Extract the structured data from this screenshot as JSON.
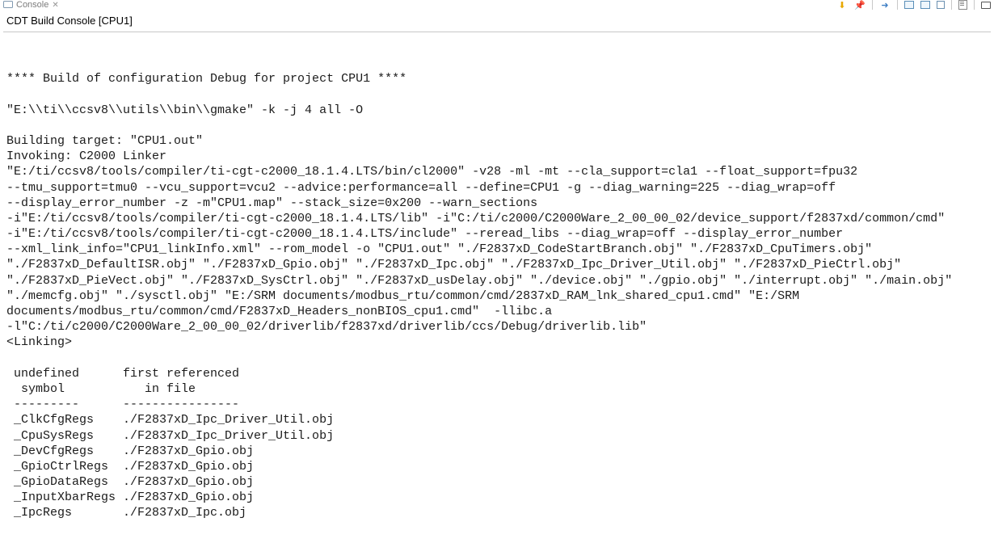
{
  "tab": {
    "title": "Console"
  },
  "header": {
    "title": "CDT Build Console [CPU1]"
  },
  "console": {
    "lines": [
      "",
      "**** Build of configuration Debug for project CPU1 ****",
      "",
      "\"E:\\\\ti\\\\ccsv8\\\\utils\\\\bin\\\\gmake\" -k -j 4 all -O ",
      "",
      "Building target: \"CPU1.out\"",
      "Invoking: C2000 Linker",
      "\"E:/ti/ccsv8/tools/compiler/ti-cgt-c2000_18.1.4.LTS/bin/cl2000\" -v28 -ml -mt --cla_support=cla1 --float_support=fpu32",
      "--tmu_support=tmu0 --vcu_support=vcu2 --advice:performance=all --define=CPU1 -g --diag_warning=225 --diag_wrap=off",
      "--display_error_number -z -m\"CPU1.map\" --stack_size=0x200 --warn_sections",
      "-i\"E:/ti/ccsv8/tools/compiler/ti-cgt-c2000_18.1.4.LTS/lib\" -i\"C:/ti/c2000/C2000Ware_2_00_00_02/device_support/f2837xd/common/cmd\"",
      "-i\"E:/ti/ccsv8/tools/compiler/ti-cgt-c2000_18.1.4.LTS/include\" --reread_libs --diag_wrap=off --display_error_number",
      "--xml_link_info=\"CPU1_linkInfo.xml\" --rom_model -o \"CPU1.out\" \"./F2837xD_CodeStartBranch.obj\" \"./F2837xD_CpuTimers.obj\"",
      "\"./F2837xD_DefaultISR.obj\" \"./F2837xD_Gpio.obj\" \"./F2837xD_Ipc.obj\" \"./F2837xD_Ipc_Driver_Util.obj\" \"./F2837xD_PieCtrl.obj\"",
      "\"./F2837xD_PieVect.obj\" \"./F2837xD_SysCtrl.obj\" \"./F2837xD_usDelay.obj\" \"./device.obj\" \"./gpio.obj\" \"./interrupt.obj\" \"./main.obj\"",
      "\"./memcfg.obj\" \"./sysctl.obj\" \"E:/SRM documents/modbus_rtu/common/cmd/2837xD_RAM_lnk_shared_cpu1.cmd\" \"E:/SRM",
      "documents/modbus_rtu/common/cmd/F2837xD_Headers_nonBIOS_cpu1.cmd\"  -llibc.a",
      "-l\"C:/ti/c2000/C2000Ware_2_00_00_02/driverlib/f2837xd/driverlib/ccs/Debug/driverlib.lib\" ",
      "<Linking>",
      "",
      " undefined      first referenced",
      "  symbol           in file       ",
      " ---------      ----------------",
      " _ClkCfgRegs    ./F2837xD_Ipc_Driver_Util.obj",
      " _CpuSysRegs    ./F2837xD_Ipc_Driver_Util.obj",
      " _DevCfgRegs    ./F2837xD_Gpio.obj",
      " _GpioCtrlRegs  ./F2837xD_Gpio.obj",
      " _GpioDataRegs  ./F2837xD_Gpio.obj",
      " _InputXbarRegs ./F2837xD_Gpio.obj",
      " _IpcRegs       ./F2837xD_Ipc.obj"
    ]
  }
}
